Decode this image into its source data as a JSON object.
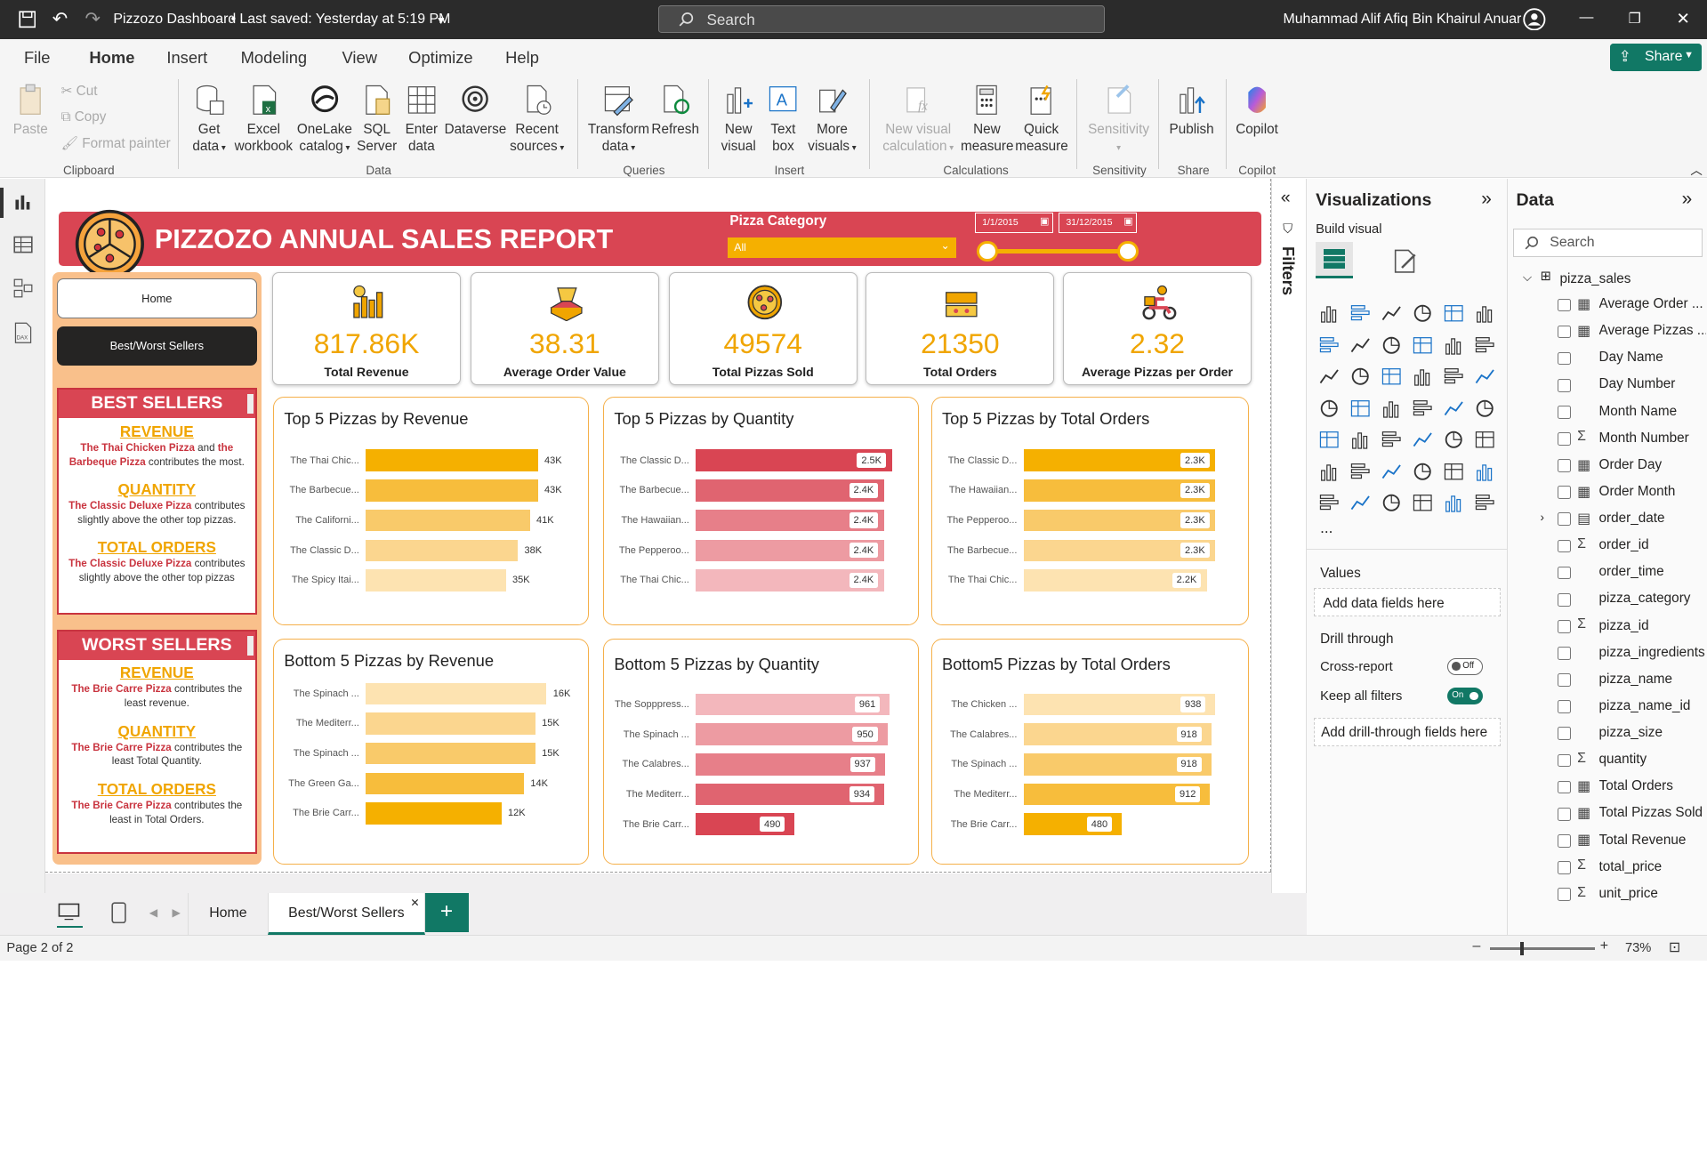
{
  "titlebar": {
    "doc_title": "Pizzozo Dashboard",
    "saved": "Last saved: Yesterday at 5:19 PM",
    "search_placeholder": "Search",
    "user": "Muhammad Alif Afiq Bin Khairul Anuar"
  },
  "menu": [
    "File",
    "Home",
    "Insert",
    "Modeling",
    "View",
    "Optimize",
    "Help"
  ],
  "share_label": "Share",
  "ribbon": {
    "clipboard": {
      "paste": "Paste",
      "cut": "Cut",
      "copy": "Copy",
      "format_painter": "Format painter",
      "group": "Clipboard"
    },
    "data": {
      "get_data_1": "Get",
      "get_data_2": "data",
      "excel_1": "Excel",
      "excel_2": "workbook",
      "onelake_1": "OneLake",
      "onelake_2": "catalog",
      "sql_1": "SQL",
      "sql_2": "Server",
      "enter_1": "Enter",
      "enter_2": "data",
      "dataverse": "Dataverse",
      "recent_1": "Recent",
      "recent_2": "sources",
      "group": "Data"
    },
    "queries": {
      "transform_1": "Transform",
      "transform_2": "data",
      "refresh": "Refresh",
      "group": "Queries"
    },
    "insert": {
      "new_visual_1": "New",
      "new_visual_2": "visual",
      "text_box_1": "Text",
      "text_box_2": "box",
      "more_1": "More",
      "more_2": "visuals",
      "group": "Insert"
    },
    "calculations": {
      "nvc_1": "New visual",
      "nvc_2": "calculation",
      "nm_1": "New",
      "nm_2": "measure",
      "qm_1": "Quick",
      "qm_2": "measure",
      "group": "Calculations"
    },
    "sensitivity": {
      "label": "Sensitivity",
      "group": "Sensitivity"
    },
    "share": {
      "publish": "Publish",
      "group": "Share"
    },
    "copilot": {
      "label": "Copilot",
      "group": "Copilot"
    }
  },
  "report": {
    "title": "PIZZOZO ANNUAL SALES REPORT",
    "slicer": {
      "label": "Pizza Category",
      "value": "All",
      "date_from": "1/1/2015",
      "date_to": "31/12/2015"
    },
    "nav": {
      "home": "Home",
      "best_worst": "Best/Worst Sellers"
    },
    "kpis": [
      {
        "value": "817.86K",
        "label": "Total Revenue",
        "icon": "money-bars-icon"
      },
      {
        "value": "38.31",
        "label": "Average Order Value",
        "icon": "pizza-box-icon"
      },
      {
        "value": "49574",
        "label": "Total Pizzas Sold",
        "icon": "pizza-icon"
      },
      {
        "value": "21350",
        "label": "Total Orders",
        "icon": "pizza-order-icon"
      },
      {
        "value": "2.32",
        "label": "Average Pizzas per Order",
        "icon": "delivery-scooter-icon"
      }
    ],
    "best_sellers": {
      "title": "BEST SELLERS",
      "revenue": {
        "k": "REVENUE",
        "p1": "The Thai Chicken Pizza",
        "m1": " and ",
        "p2": "the Barbeque Pizza",
        "m2": " contributes the most."
      },
      "quantity": {
        "k": "QUANTITY",
        "p1": "The Classic Deluxe Pizza",
        "m1": " contributes slightly above the other top pizzas."
      },
      "orders": {
        "k": "TOTAL ORDERS",
        "p1": "The Classic Deluxe Pizza",
        "m1": " contributes slightly above the other top pizzas"
      }
    },
    "worst_sellers": {
      "title": "WORST SELLERS",
      "revenue": {
        "k": "REVENUE",
        "p1": "The Brie Carre Pizza",
        "m1": " contributes the least revenue."
      },
      "quantity": {
        "k": "QUANTITY",
        "p1": "The Brie Carre Pizza",
        "m1": " contributes the least Total Quantity."
      },
      "orders": {
        "k": "TOTAL ORDERS",
        "p1": "The Brie Carre Pizza",
        "m1": " contributes the least in Total Orders."
      }
    }
  },
  "chart_data": [
    {
      "type": "bar",
      "title": "Top 5 Pizzas by Revenue",
      "categories": [
        "The Thai Chic...",
        "The Barbecue...",
        "The Californi...",
        "The Classic D...",
        "The Spicy Itai..."
      ],
      "values": [
        43,
        43,
        41,
        38,
        35
      ],
      "labels": [
        "43K",
        "43K",
        "41K",
        "38K",
        "35K"
      ],
      "xlim": [
        0,
        43
      ],
      "colors": [
        "#f5b000",
        "#f7bd3c",
        "#f9ca6a",
        "#fbd68f",
        "#fde3b1"
      ],
      "label_style": "outside"
    },
    {
      "type": "bar",
      "title": "Top 5 Pizzas by Quantity",
      "categories": [
        "The Classic D...",
        "The Barbecue...",
        "The Hawaiian...",
        "The Pepperoo...",
        "The Thai Chic..."
      ],
      "values": [
        2.5,
        2.4,
        2.4,
        2.4,
        2.4
      ],
      "labels": [
        "2.5K",
        "2.4K",
        "2.4K",
        "2.4K",
        "2.4K"
      ],
      "xlim": [
        0,
        2.5
      ],
      "colors": [
        "#d94553",
        "#e06470",
        "#e77f89",
        "#ed9ba2",
        "#f3b7bc"
      ],
      "label_style": "pill"
    },
    {
      "type": "bar",
      "title": "Top 5 Pizzas by Total Orders",
      "categories": [
        "The Classic D...",
        "The Hawaiian...",
        "The Pepperoo...",
        "The Barbecue...",
        "The Thai Chic..."
      ],
      "values": [
        2.3,
        2.3,
        2.3,
        2.3,
        2.2
      ],
      "labels": [
        "2.3K",
        "2.3K",
        "2.3K",
        "2.3K",
        "2.2K"
      ],
      "xlim": [
        0,
        2.3
      ],
      "colors": [
        "#f5b000",
        "#f7bd3c",
        "#f9ca6a",
        "#fbd68f",
        "#fde3b1"
      ],
      "label_style": "pill"
    },
    {
      "type": "bar",
      "title": "Bottom 5 Pizzas by Revenue",
      "categories": [
        "The Spinach ...",
        "The Mediterr...",
        "The Spinach ...",
        "The Green Ga...",
        "The Brie Carr..."
      ],
      "values": [
        16,
        15,
        15,
        14,
        12
      ],
      "labels": [
        "16K",
        "15K",
        "15K",
        "14K",
        "12K"
      ],
      "xlim": [
        0,
        16
      ],
      "colors": [
        "#fde3b1",
        "#fbd68f",
        "#f9ca6a",
        "#f7bd3c",
        "#f5b000"
      ],
      "label_style": "outside"
    },
    {
      "type": "bar",
      "title": "Bottom 5 Pizzas by Quantity",
      "categories": [
        "The Sopppress...",
        "The Spinach ...",
        "The Calabres...",
        "The Mediterr...",
        "The Brie Carr..."
      ],
      "values": [
        961,
        950,
        937,
        934,
        490
      ],
      "labels": [
        "961",
        "950",
        "937",
        "934",
        "490"
      ],
      "xlim": [
        0,
        961
      ],
      "colors": [
        "#f3b7bc",
        "#ed9ba2",
        "#e77f89",
        "#e06470",
        "#d94553"
      ],
      "label_style": "pill"
    },
    {
      "type": "bar",
      "title": "Bottom5 Pizzas by Total Orders",
      "categories": [
        "The Chicken ...",
        "The Calabres...",
        "The Spinach ...",
        "The Mediterr...",
        "The Brie Carr..."
      ],
      "values": [
        938,
        918,
        918,
        912,
        480
      ],
      "labels": [
        "938",
        "918",
        "918",
        "912",
        "480"
      ],
      "xlim": [
        0,
        938
      ],
      "colors": [
        "#fde3b1",
        "#fbd68f",
        "#f9ca6a",
        "#f7bd3c",
        "#f5b000"
      ],
      "label_style": "pill"
    }
  ],
  "filters_label": "Filters",
  "viz_pane": {
    "title": "Visualizations",
    "build": "Build visual",
    "values": "Values",
    "add_data": "Add data fields here",
    "drill": "Drill through",
    "cross": "Cross-report",
    "cross_state": "Off",
    "keep": "Keep all filters",
    "keep_state": "On",
    "add_drill": "Add drill-through fields here",
    "more": "..."
  },
  "data_pane": {
    "title": "Data",
    "search_placeholder": "Search",
    "table": "pizza_sales",
    "fields": [
      {
        "sig": "▦",
        "name": "Average Order ..."
      },
      {
        "sig": "▦",
        "name": "Average Pizzas ..."
      },
      {
        "sig": "",
        "name": "Day Name"
      },
      {
        "sig": "",
        "name": "Day Number"
      },
      {
        "sig": "",
        "name": "Month Name"
      },
      {
        "sig": "Σ",
        "name": "Month Number"
      },
      {
        "sig": "▦",
        "name": "Order Day"
      },
      {
        "sig": "▦",
        "name": "Order Month"
      },
      {
        "sig": "▤",
        "name": "order_date"
      },
      {
        "sig": "Σ",
        "name": "order_id"
      },
      {
        "sig": "",
        "name": "order_time"
      },
      {
        "sig": "",
        "name": "pizza_category"
      },
      {
        "sig": "Σ",
        "name": "pizza_id"
      },
      {
        "sig": "",
        "name": "pizza_ingredients"
      },
      {
        "sig": "",
        "name": "pizza_name"
      },
      {
        "sig": "",
        "name": "pizza_name_id"
      },
      {
        "sig": "",
        "name": "pizza_size"
      },
      {
        "sig": "Σ",
        "name": "quantity"
      },
      {
        "sig": "▦",
        "name": "Total Orders"
      },
      {
        "sig": "▦",
        "name": "Total Pizzas Sold"
      },
      {
        "sig": "▦",
        "name": "Total Revenue"
      },
      {
        "sig": "Σ",
        "name": "total_price"
      },
      {
        "sig": "Σ",
        "name": "unit_price"
      }
    ]
  },
  "pages": [
    "Home",
    "Best/Worst Sellers"
  ],
  "status": {
    "page": "Page 2 of 2",
    "zoom": "73%"
  },
  "colors": {
    "accent": "#117865",
    "red": "#d94553",
    "gold": "#f5b000"
  }
}
